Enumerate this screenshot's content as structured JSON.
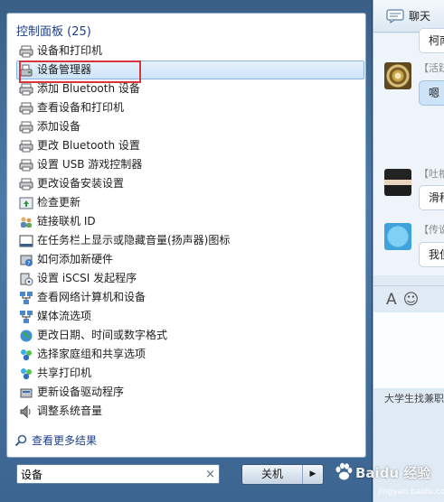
{
  "start_menu": {
    "group_header": "控制面板 (25)",
    "items": [
      {
        "label": "设备和打印机",
        "icon": "printer-icon"
      },
      {
        "label": "设备管理器",
        "icon": "device-manager-icon",
        "selected": true
      },
      {
        "label": "添加 Bluetooth 设备",
        "icon": "printer-icon"
      },
      {
        "label": "查看设备和打印机",
        "icon": "printer-icon"
      },
      {
        "label": "添加设备",
        "icon": "printer-icon"
      },
      {
        "label": "更改 Bluetooth 设置",
        "icon": "printer-icon"
      },
      {
        "label": "设置 USB 游戏控制器",
        "icon": "printer-icon"
      },
      {
        "label": "更改设备安装设置",
        "icon": "printer-icon"
      },
      {
        "label": "检查更新",
        "icon": "update-icon"
      },
      {
        "label": "链接联机 ID",
        "icon": "users-icon"
      },
      {
        "label": "在任务栏上显示或隐藏音量(扬声器)图标",
        "icon": "taskbar-icon"
      },
      {
        "label": "如何添加新硬件",
        "icon": "help-icon"
      },
      {
        "label": "设置 iSCSI 发起程序",
        "icon": "iscsi-icon"
      },
      {
        "label": "查看网络计算机和设备",
        "icon": "network-icon"
      },
      {
        "label": "媒体流选项",
        "icon": "network-icon"
      },
      {
        "label": "更改日期、时间或数字格式",
        "icon": "globe-icon"
      },
      {
        "label": "选择家庭组和共享选项",
        "icon": "homegroup-icon"
      },
      {
        "label": "共享打印机",
        "icon": "homegroup-icon"
      },
      {
        "label": "更新设备驱动程序",
        "icon": "driver-icon"
      },
      {
        "label": "调整系统音量",
        "icon": "speaker-icon"
      }
    ],
    "more_results": "查看更多结果",
    "search_value": "设备",
    "search_clear": "×",
    "shutdown_label": "关机",
    "shutdown_arrow": "▶"
  },
  "chat": {
    "title": "聊天",
    "messages": [
      {
        "text": "柯南"
      },
      {
        "name": "【活跃",
        "text": "嗯"
      },
      {
        "name": "【吐槽",
        "text": "滑稽"
      },
      {
        "name": "【传说",
        "text": "我但"
      }
    ],
    "toolbar": [
      "A",
      "☺"
    ],
    "footer": "大学生找兼职"
  },
  "watermark": {
    "brand": "Baidu 经验",
    "sub": "jingyan.baidu.com"
  }
}
